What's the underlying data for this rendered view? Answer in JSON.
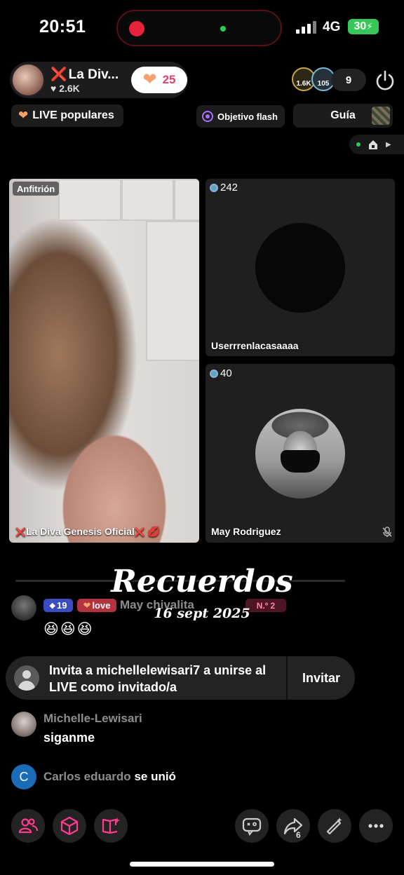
{
  "status_bar": {
    "time": "20:51",
    "network": "4G",
    "battery": "30"
  },
  "host": {
    "name": "La Div...",
    "likes": "2.6K",
    "heart_count": "25"
  },
  "viewers": {
    "badge1": "1.6K",
    "badge2": "105",
    "count": "9"
  },
  "chips": {
    "popular": "LIVE populares",
    "goal": "Objetivo flash",
    "guide": "Guía"
  },
  "tiles": {
    "host_badge": "Anfitrión",
    "host_name": "La Diva Genesis Oficial",
    "guest1_viewers": "242",
    "guest1_name": "Userrrenlacasaaaa",
    "guest2_viewers": "40",
    "guest2_name": "May Rodriguez"
  },
  "watermark": {
    "title": "Recuerdos",
    "date": "16 sept 2025"
  },
  "chat": [
    {
      "level": "19",
      "fan_badge": "love",
      "name": "May chivalita",
      "rank": "N.º 2",
      "message": "😆😆😆"
    },
    {
      "name": "Michelle-Lewisari",
      "message": "siganme"
    },
    {
      "avatar_letter": "C",
      "name": "Carlos eduardo",
      "action": "se unió"
    }
  ],
  "invite": {
    "text": "Invita a michellelewisari7 a unirse al LIVE como invitado/a",
    "button": "Invitar"
  },
  "bottom_bar": {
    "share_count": "6"
  },
  "colors": {
    "accent_red": "#e2283c",
    "heart": "#f5a36a",
    "level_badge": "#3b4cc0",
    "fan_badge": "#b3343e",
    "pink_icon": "#ff3b8d"
  }
}
